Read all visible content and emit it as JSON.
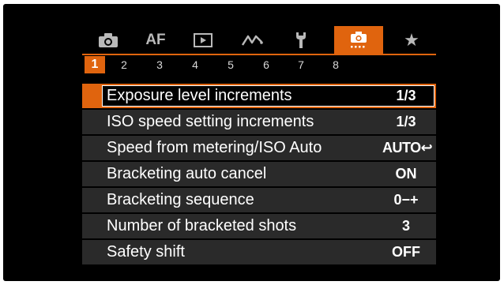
{
  "tabs": [
    {
      "icon": "camera-icon",
      "active": false
    },
    {
      "text": "AF",
      "icon": "af-icon",
      "active": false
    },
    {
      "icon": "playback-icon",
      "active": false
    },
    {
      "icon": "wireless-icon",
      "active": false
    },
    {
      "icon": "wrench-icon",
      "active": false
    },
    {
      "icon": "custom-functions-icon",
      "active": true
    },
    {
      "icon": "star-icon",
      "active": false
    }
  ],
  "pages": [
    "1",
    "2",
    "3",
    "4",
    "5",
    "6",
    "7",
    "8"
  ],
  "active_page": "1",
  "menu": [
    {
      "label": "Exposure level increments",
      "value": "1/3",
      "selected": true
    },
    {
      "label": "ISO speed setting increments",
      "value": "1/3",
      "selected": false
    },
    {
      "label": "Speed from metering/ISO Auto",
      "value": "AUTO↩",
      "selected": false
    },
    {
      "label": "Bracketing auto cancel",
      "value": "ON",
      "selected": false
    },
    {
      "label": "Bracketing sequence",
      "value": "0−+",
      "selected": false
    },
    {
      "label": "Number of bracketed shots",
      "value": "3",
      "selected": false
    },
    {
      "label": "Safety shift",
      "value": "OFF",
      "selected": false
    }
  ],
  "colors": {
    "accent": "#e0640e",
    "row_bg": "#2a2a2a",
    "screen_bg": "#000000"
  }
}
